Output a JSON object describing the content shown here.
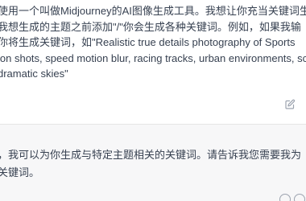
{
  "user_message": {
    "lines": [
      "使用一个叫做Midjourney的AI图像生成工具。我想让你充当关键词生",
      "我想生成的主题之前添加\"/\"你会生成各种关键词。例如，如果我输",
      "你将生成关键词，如\"Realistic true details photography of Sports",
      "ion shots, speed motion blur, racing tracks, urban environments, sc",
      "dramatic skies\""
    ],
    "edit_icon": "edit-icon"
  },
  "assistant_message": {
    "lines": [
      "，我可以为你生成与特定主题相关的关键词。请告诉我您需要我为",
      "关键词。"
    ]
  },
  "colors": {
    "user_bg": "#ffffff",
    "assistant_bg": "#f7f7f8",
    "text": "#374151",
    "icon": "#9ca3af"
  }
}
